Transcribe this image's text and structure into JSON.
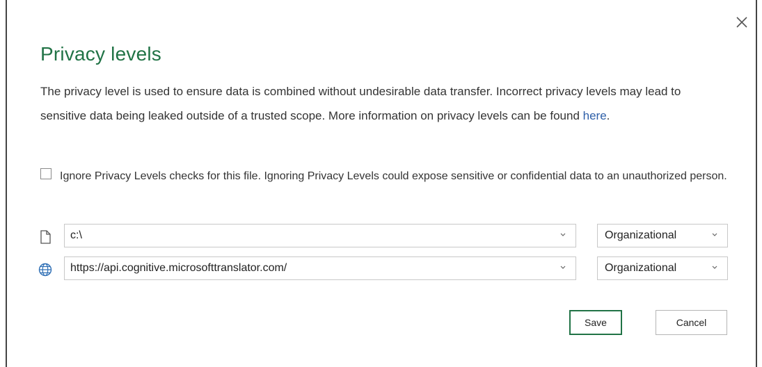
{
  "dialog": {
    "title": "Privacy levels",
    "description_text": "The privacy level is used to ensure data is combined without undesirable data transfer. Incorrect privacy levels may lead to sensitive data being leaked outside of a trusted scope. More information on privacy levels can be found ",
    "description_link": "here",
    "description_end": ".",
    "ignore_checkbox": {
      "checked": false,
      "label": "Ignore Privacy Levels checks for this file. Ignoring Privacy Levels could expose sensitive or confidential data to an unauthorized person."
    },
    "sources": [
      {
        "icon": "file-icon",
        "path": "c:\\",
        "level": "Organizational"
      },
      {
        "icon": "globe-icon",
        "path": "https://api.cognitive.microsofttranslator.com/",
        "level": "Organizational"
      }
    ],
    "save_label": "Save",
    "cancel_label": "Cancel"
  },
  "colors": {
    "accent": "#217346",
    "link": "#2e5fa8",
    "globe": "#2f6fb5"
  }
}
